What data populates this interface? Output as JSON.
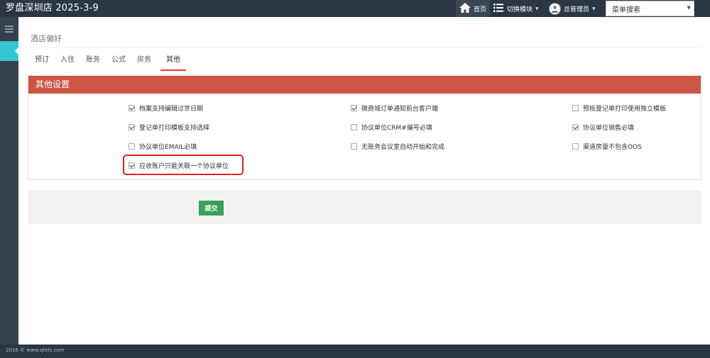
{
  "header": {
    "brand": "罗盘深圳店 2025-3-9",
    "home_label": "首页",
    "switch_label": "切换模块",
    "user_label": "总管理员",
    "menu_search": "菜单搜索"
  },
  "page": {
    "title": "酒店偏好",
    "tabs": [
      {
        "label": "预订"
      },
      {
        "label": "入住"
      },
      {
        "label": "账务"
      },
      {
        "label": "公式"
      },
      {
        "label": "房务"
      },
      {
        "label": "其他"
      }
    ],
    "active_tab": "其他"
  },
  "panel": {
    "title": "其他设置",
    "options": [
      {
        "label": "档案支持编辑过世日期",
        "checked": true
      },
      {
        "label": "微商城订单通知前台客户端",
        "checked": true
      },
      {
        "label": "预抵登记单打印使用独立模板",
        "checked": false
      },
      {
        "label": "登记单打印模板支持选择",
        "checked": true
      },
      {
        "label": "协议单位CRM#编号必填",
        "checked": false
      },
      {
        "label": "协议单位销售必填",
        "checked": true
      },
      {
        "label": "协议单位EMAIL必填",
        "checked": false
      },
      {
        "label": "无账务会议室自动开始和完成",
        "checked": false
      },
      {
        "label": "渠道房量不包含OOS",
        "checked": false
      },
      {
        "label": "应收账户只能关联一个协议单位",
        "checked": true
      }
    ]
  },
  "actions": {
    "submit_label": "提交"
  },
  "footer": {
    "text": "2016 © www.qtels.com"
  }
}
